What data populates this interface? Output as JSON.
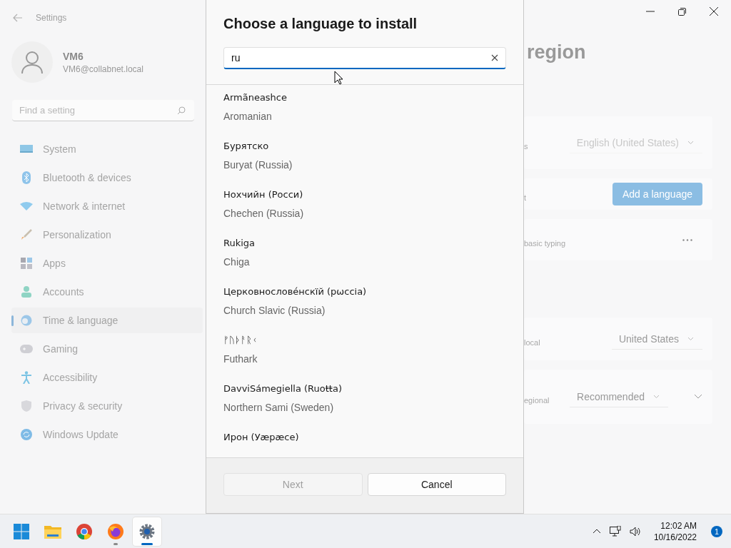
{
  "window": {
    "title": "Settings"
  },
  "account": {
    "name": "VM6",
    "email": "VM6@collabnet.local"
  },
  "search": {
    "placeholder": "Find a setting"
  },
  "nav": [
    {
      "label": "System",
      "kind": "system",
      "selected": false
    },
    {
      "label": "Bluetooth & devices",
      "kind": "bluetooth",
      "selected": false
    },
    {
      "label": "Network & internet",
      "kind": "network",
      "selected": false
    },
    {
      "label": "Personalization",
      "kind": "brush",
      "selected": false
    },
    {
      "label": "Apps",
      "kind": "apps",
      "selected": false
    },
    {
      "label": "Accounts",
      "kind": "accounts",
      "selected": false
    },
    {
      "label": "Time & language",
      "kind": "time",
      "selected": true
    },
    {
      "label": "Gaming",
      "kind": "gaming",
      "selected": false
    },
    {
      "label": "Accessibility",
      "kind": "accessibility",
      "selected": false
    },
    {
      "label": "Privacy & security",
      "kind": "privacy",
      "selected": false
    },
    {
      "label": "Windows Update",
      "kind": "update",
      "selected": false
    }
  ],
  "page": {
    "title": "region"
  },
  "settings_rows": [
    {
      "kind": "dropdown",
      "label": "s",
      "value": "English (United States)",
      "disabled": true
    },
    {
      "kind": "button",
      "label": "t",
      "button": "Add a language"
    },
    {
      "kind": "more",
      "label": "basic typing"
    },
    {
      "kind": "dropdown",
      "label": "local",
      "value": "United States",
      "disabled": false
    },
    {
      "kind": "dropdown_expand",
      "label": "egional",
      "value": "Recommended",
      "disabled": false
    }
  ],
  "dialog": {
    "title": "Choose a language to install",
    "search": {
      "value": "ru"
    },
    "languages": [
      {
        "native": "Armãneashce",
        "english": "Aromanian"
      },
      {
        "native": "Бурятско",
        "english": "Buryat (Russia)"
      },
      {
        "native": "Нохчийн (Росси)",
        "english": "Chechen (Russia)"
      },
      {
        "native": "Rukiga",
        "english": "Chiga"
      },
      {
        "native": "Церковнослове́нскїй (рѡссіа)",
        "english": "Church Slavic (Russia)"
      },
      {
        "native": "ᚠᚢᚦᚨᚱᚲ",
        "english": "Futhark"
      },
      {
        "native": "DavviSámegiella (Ruoŧŧa)",
        "english": "Northern Sami (Sweden)"
      },
      {
        "native": "Ирон (Уæрæсе)"
      }
    ],
    "buttons": [
      {
        "label": "Next",
        "disabled": true
      },
      {
        "label": "Cancel",
        "disabled": false
      }
    ]
  },
  "taskbar": {
    "apps": [
      {
        "kind": "start",
        "running": false,
        "selected": false
      },
      {
        "kind": "explorer",
        "running": false,
        "selected": false
      },
      {
        "kind": "chrome",
        "running": false,
        "selected": false
      },
      {
        "kind": "firefox",
        "running": true,
        "selected": false
      },
      {
        "kind": "settings",
        "running": true,
        "selected": true
      }
    ],
    "time": "12:02 AM",
    "date": "10/16/2022",
    "notifications": "1"
  }
}
